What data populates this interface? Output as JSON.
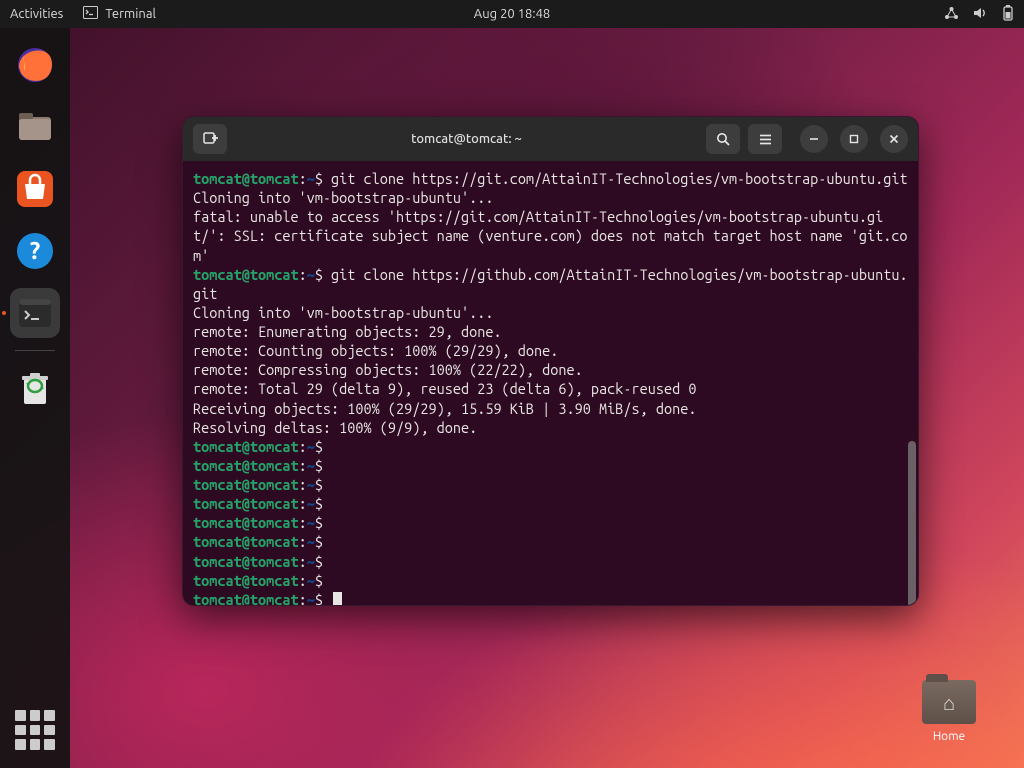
{
  "topbar": {
    "activities": "Activities",
    "app_icon": "terminal-icon",
    "app_name": "Terminal",
    "datetime": "Aug 20  18:48"
  },
  "dock": {
    "items": [
      {
        "name": "firefox",
        "active": false
      },
      {
        "name": "files",
        "active": false
      },
      {
        "name": "software",
        "active": false
      },
      {
        "name": "help",
        "active": false
      },
      {
        "name": "terminal",
        "active": true
      },
      {
        "name": "trash",
        "active": false
      }
    ]
  },
  "desktop": {
    "home_label": "Home"
  },
  "window": {
    "title": "tomcat@tomcat: ~",
    "prompt_user": "tomcat@tomcat",
    "prompt_path": "~",
    "lines": [
      {
        "type": "cmd",
        "text": "git clone https://git.com/AttainIT-Technologies/vm-bootstrap-ubuntu.git"
      },
      {
        "type": "out",
        "text": "Cloning into 'vm-bootstrap-ubuntu'..."
      },
      {
        "type": "out",
        "text": "fatal: unable to access 'https://git.com/AttainIT-Technologies/vm-bootstrap-ubuntu.git/': SSL: certificate subject name (venture.com) does not match target host name 'git.com'"
      },
      {
        "type": "cmd",
        "text": "git clone https://github.com/AttainIT-Technologies/vm-bootstrap-ubuntu.git"
      },
      {
        "type": "out",
        "text": "Cloning into 'vm-bootstrap-ubuntu'..."
      },
      {
        "type": "out",
        "text": "remote: Enumerating objects: 29, done."
      },
      {
        "type": "out",
        "text": "remote: Counting objects: 100% (29/29), done."
      },
      {
        "type": "out",
        "text": "remote: Compressing objects: 100% (22/22), done."
      },
      {
        "type": "out",
        "text": "remote: Total 29 (delta 9), reused 23 (delta 6), pack-reused 0"
      },
      {
        "type": "out",
        "text": "Receiving objects: 100% (29/29), 15.59 KiB | 3.90 MiB/s, done."
      },
      {
        "type": "out",
        "text": "Resolving deltas: 100% (9/9), done."
      },
      {
        "type": "empty"
      },
      {
        "type": "empty"
      },
      {
        "type": "empty"
      },
      {
        "type": "empty"
      },
      {
        "type": "empty"
      },
      {
        "type": "empty"
      },
      {
        "type": "empty"
      },
      {
        "type": "empty"
      },
      {
        "type": "cursor"
      }
    ]
  },
  "colors": {
    "prompt_user": "#26a269",
    "prompt_path": "#12488b",
    "terminal_bg": "#2d0a22",
    "accent": "#e95420"
  }
}
